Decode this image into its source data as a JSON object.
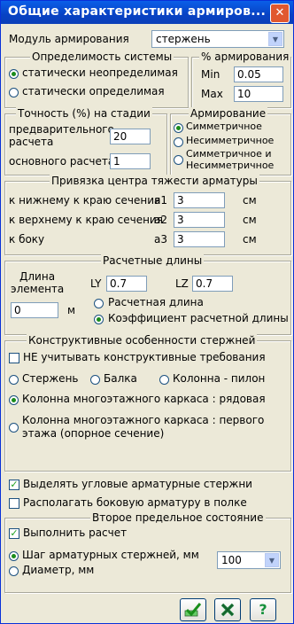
{
  "window": {
    "title": "Общие характеристики армиров...",
    "close_label": "✕"
  },
  "module": {
    "label": "Модуль армирования",
    "value": "стержень"
  },
  "determinacy": {
    "legend": "Определимость системы",
    "options": [
      "статически неопределимая",
      "статически определимая"
    ],
    "selected": 0
  },
  "reinforcement_pct": {
    "legend": "% армирования",
    "min_label": "Min",
    "min_value": "0.05",
    "max_label": "Max",
    "max_value": "10"
  },
  "accuracy": {
    "legend": "Точность (%) на стадии",
    "preliminary_label_1": "предварительного",
    "preliminary_label_2": "расчета",
    "preliminary_value": "20",
    "main_label": "основного расчета",
    "main_value": "1"
  },
  "reinforcement": {
    "legend": "Армирование",
    "options": [
      "Симметричное",
      "Несимметричное",
      "Симметричное и",
      "Несимметричное"
    ],
    "selected": 0
  },
  "anchor": {
    "legend": "Привязка  центра тяжести арматуры",
    "rows": [
      {
        "label": "к нижнему к краю сечения",
        "code": "a1",
        "value": "3",
        "unit": "см"
      },
      {
        "label": "к верхнему к краю сечения",
        "code": "a2",
        "value": "3",
        "unit": "см"
      },
      {
        "label": "к боку",
        "code": "a3",
        "value": "3",
        "unit": "см"
      }
    ]
  },
  "lengths": {
    "legend": "Расчетные длины",
    "element_label_1": "Длина",
    "element_label_2": "элемента",
    "element_value": "0",
    "element_unit": "м",
    "ly_label": "LY",
    "ly_value": "0.7",
    "lz_label": "LZ",
    "lz_value": "0.7",
    "options": [
      "Расчетная длина",
      "Коэффициент расчетной длины"
    ],
    "selected": 1
  },
  "design": {
    "legend": "Конструктивные особенности стержней",
    "ignore_label": "НЕ учитывать конструктивные требования",
    "ignore_checked": false,
    "types": [
      "Стержень",
      "Балка",
      "Колонна - пилон"
    ],
    "frame_row": "Колонна многоэтажного каркаса : рядовая",
    "frame_first_1": "Колонна многоэтажного каркаса : первого",
    "frame_first_2": "этажа (опорное сечение)",
    "selected": "frame_row"
  },
  "options": {
    "corner_label": "Выделять угловые арматурные стержни",
    "corner_checked": true,
    "side_label": "Располагать боковую арматуру в полке",
    "side_checked": false
  },
  "second_state": {
    "legend": "Второе предельное состояние",
    "run_label": "Выполнить расчет",
    "run_checked": true,
    "step_label": "Шаг арматурных стержней, мм",
    "diameter_label": "Диаметр, мм",
    "selected": "step",
    "value": "100"
  },
  "buttons": {
    "ok_icon": "check-icon",
    "cancel_icon": "cross-icon",
    "help_icon": "question-icon",
    "help_label": "?"
  }
}
